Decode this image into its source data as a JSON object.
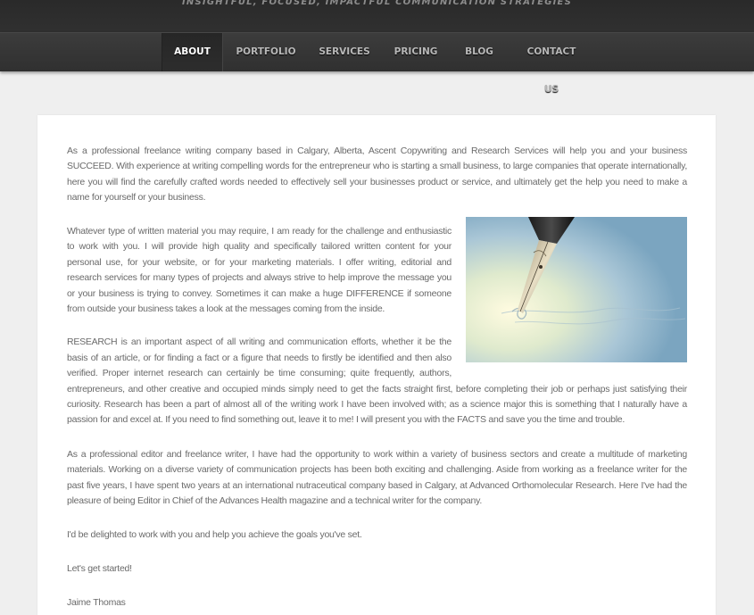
{
  "header": {
    "tagline": "INSIGHTFUL, FOCUSED, IMPACTFUL COMMUNICATION STRATEGIES"
  },
  "nav": {
    "items": [
      {
        "label": "ABOUT",
        "active": true
      },
      {
        "label": "PORTFOLIO",
        "active": false
      },
      {
        "label": "SERVICES",
        "active": false
      },
      {
        "label": "PRICING",
        "active": false
      },
      {
        "label": "BLOG",
        "active": false
      },
      {
        "label": "CONTACT US",
        "active": false
      }
    ]
  },
  "content": {
    "p1": "As a professional freelance writing company based in Calgary, Alberta, Ascent Copywriting and Research Services will help you and your business SUCCEED. With experience at writing compelling words for the entrepreneur who is starting a small business, to large companies that operate internationally, here you will find the carefully crafted words needed to effectively sell your businesses product or service, and ultimately get the help you need to make a name for yourself or your business.",
    "p2": "Whatever type of written material you may require, I am ready for the challenge and enthusiastic to work with you. I will provide high quality and specifically tailored written content for your personal use, for your website, or for your marketing materials. I offer writing, editorial and research services for many types of projects and always strive to help improve the message you or your business is trying to convey. Sometimes it can make a huge DIFFERENCE if someone from outside your business takes a look at the messages coming from the inside.",
    "p3": "RESEARCH is an important aspect of all writing and communication efforts, whether it be the basis of an article, or for finding a fact or a figure that needs to firstly be identified and then also verified. Proper internet research can certainly be time consuming; quite frequently, authors, entrepreneurs, and other creative and occupied minds simply need to get the facts straight first, before completing their job or perhaps just satisfying their curiosity. Research has been a part of almost all of the writing work I have been involved with; as a science major this is something that I naturally have a passion for and excel at. If you need to find something out, leave it to me! I will present you with the FACTS and save you the time and trouble.",
    "p4": "As a professional editor and freelance writer, I have had the opportunity to work within a variety of business sectors and create a multitude of marketing materials. Working on a diverse variety of communication projects has been both exciting and challenging. Aside from working as a freelance writer for the past five years, I have spent two years at an international nutraceutical company based in Calgary, at Advanced Orthomolecular Research. Here I've had the pleasure of being Editor in Chief of the Advances Health magazine and a technical writer for the company.",
    "p5": "I'd be delighted to work with you and help you achieve the goals you've set.",
    "p6": "Let's get started!",
    "p7": "Jaime Thomas"
  }
}
